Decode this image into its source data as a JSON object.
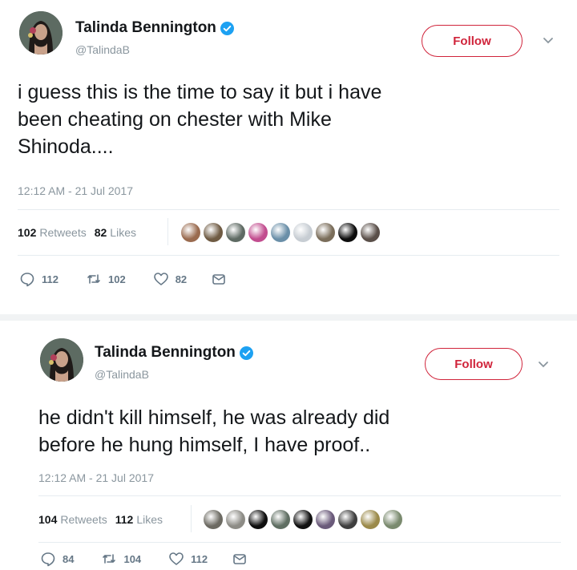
{
  "tweets": [
    {
      "display_name": "Talinda Bennington",
      "handle": "@TalindaB",
      "follow_label": "Follow",
      "text_lines": [
        "i guess this is the time to say it but i have",
        "been cheating on chester with Mike",
        "Shinoda...."
      ],
      "timestamp": "12:12 AM - 21 Jul 2017",
      "retweets_count": "102",
      "retweets_label": "Retweets",
      "likes_count": "82",
      "likes_label": "Likes",
      "actions": {
        "replies": "112",
        "retweets": "102",
        "likes": "82"
      },
      "liker_colors": [
        "#9a6b4f",
        "#6f5b43",
        "#5e6a63",
        "#c24d8f",
        "#6a8fa8",
        "#c7cdd3",
        "#7a6d5a",
        "#0d0d0d",
        "#5a4f49"
      ]
    },
    {
      "display_name": "Talinda Bennington",
      "handle": "@TalindaB",
      "follow_label": "Follow",
      "text_lines": [
        "he didn't kill himself, he was already did",
        "before he hung himself, I have proof.."
      ],
      "timestamp": "12:12 AM - 21 Jul 2017",
      "retweets_count": "104",
      "retweets_label": "Retweets",
      "likes_count": "112",
      "likes_label": "Likes",
      "actions": {
        "replies": "84",
        "retweets": "104",
        "likes": "112"
      },
      "liker_colors": [
        "#6c6a62",
        "#8d8c86",
        "#0f0f0f",
        "#5f6e62",
        "#101010",
        "#6a5a7a",
        "#3f3f3f",
        "#9b8a4a",
        "#7a8a6e"
      ]
    }
  ],
  "colors": {
    "follow_accent": "#d0243b",
    "verified_blue": "#1da1f2",
    "secondary_text": "#8a969e"
  },
  "icons": {
    "verified": "verified-badge-icon",
    "caret": "chevron-down-icon",
    "reply": "reply-icon",
    "retweet": "retweet-icon",
    "like": "heart-icon",
    "message": "direct-message-icon"
  }
}
